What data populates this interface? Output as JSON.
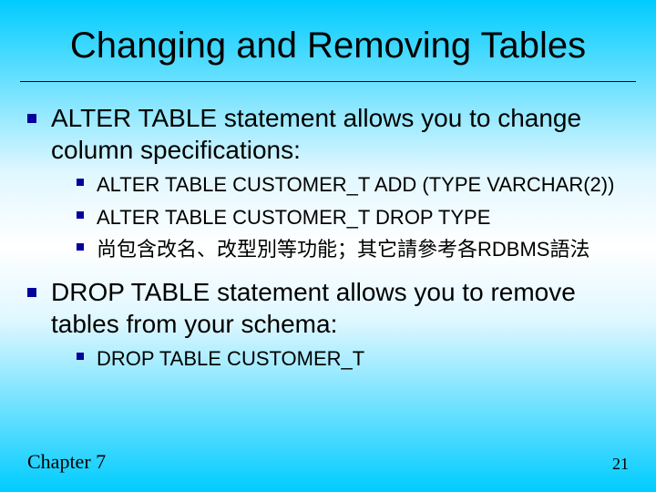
{
  "title": "Changing and Removing Tables",
  "bullets": [
    {
      "text": "ALTER TABLE statement allows you to change column specifications:",
      "sub": [
        "ALTER TABLE CUSTOMER_T ADD (TYPE VARCHAR(2))",
        "ALTER TABLE CUSTOMER_T DROP TYPE",
        "尚包含改名、改型別等功能；其它請參考各RDBMS語法"
      ]
    },
    {
      "text": "DROP TABLE statement allows you to remove tables from your schema:",
      "sub": [
        "DROP TABLE CUSTOMER_T"
      ]
    }
  ],
  "footer": {
    "chapter": "Chapter 7",
    "page": "21"
  }
}
